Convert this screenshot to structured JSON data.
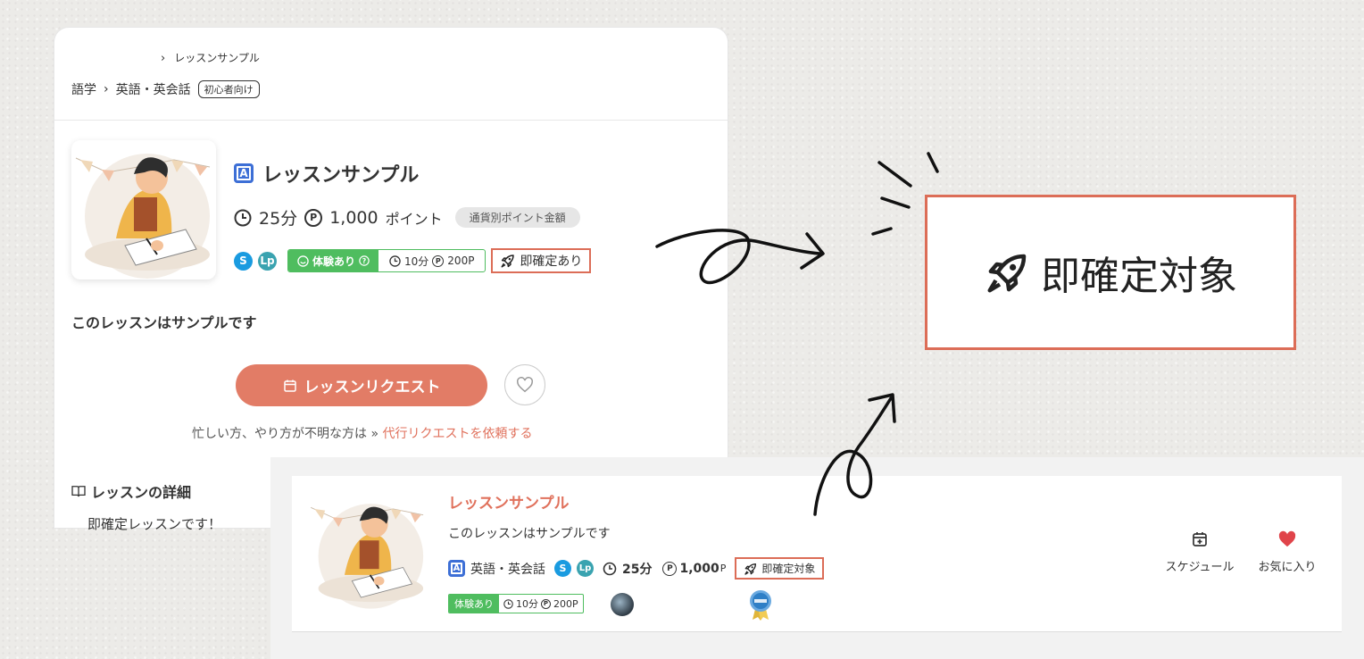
{
  "top_card": {
    "breadcrumb_small": "レッスンサンプル",
    "breadcrumb_category": "語学",
    "breadcrumb_subcategory": "英語・英会話",
    "level_tag": "初心者向け",
    "title": "レッスンサンプル",
    "alc_letter": "A",
    "duration": "25分",
    "price": "1,000",
    "price_unit": "ポイント",
    "currency_pill": "通貨別ポイント金額",
    "trial_label": "体験あり",
    "trial_duration": "10分",
    "trial_price": "200P",
    "instant_badge": "即確定あり",
    "description": "このレッスンはサンプルです",
    "request_button": "レッスンリクエスト",
    "busy_text": "忙しい方、やり方が不明な方は »",
    "busy_link": "代行リクエストを依頼する",
    "detail_heading": "レッスンの詳細",
    "detail_text": "即確定レッスンです！"
  },
  "bottom_card": {
    "title": "レッスンサンプル",
    "description": "このレッスンはサンプルです",
    "alc_letter": "A",
    "category": "英語・英会話",
    "duration": "25分",
    "price": "1,000",
    "price_unit": "P",
    "instant_badge": "即確定対象",
    "trial_label": "体験あり",
    "trial_duration": "10分",
    "trial_price": "200P",
    "schedule_label": "スケジュール",
    "favorite_label": "お気に入り"
  },
  "zoom": {
    "label": "即確定対象"
  },
  "colors": {
    "accent": "#e27c66",
    "highlight_border": "#dc6d57",
    "trial_green": "#4fbd5f",
    "alc_blue": "#3d6fd6",
    "skype_blue": "#1a9be0",
    "lp_teal": "#3aa3b0",
    "heart_red": "#e0444a"
  },
  "icons": [
    "chevron-right-icon",
    "clock-icon",
    "point-icon",
    "skype-icon",
    "lp-icon",
    "smile-icon",
    "help-icon",
    "rocket-icon",
    "calendar-icon",
    "heart-icon",
    "book-icon",
    "medal-icon"
  ]
}
